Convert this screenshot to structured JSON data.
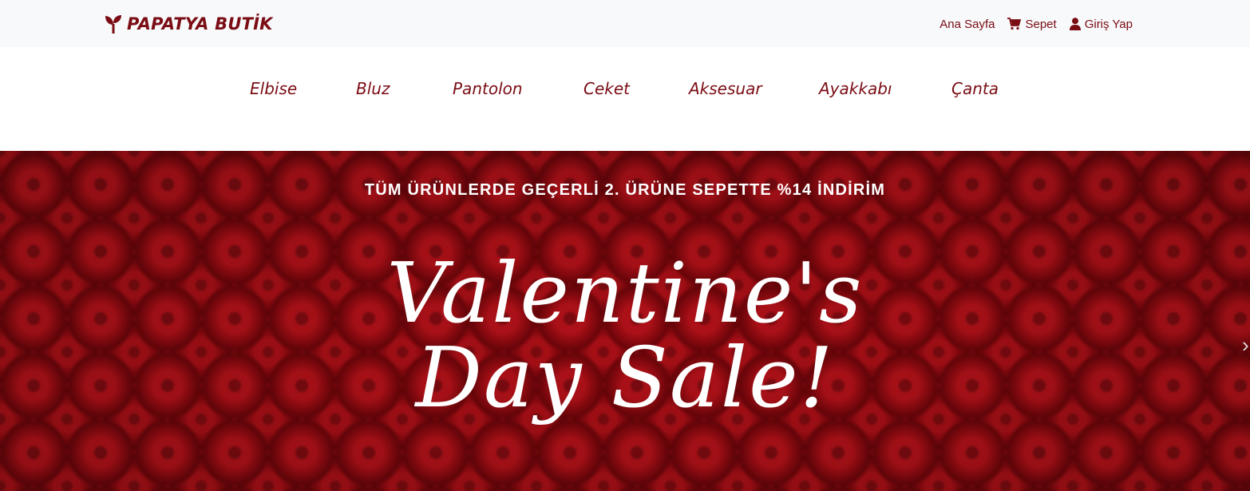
{
  "brand": {
    "name": "PAPATYA BUTİK",
    "icon": "seedling-icon",
    "color": "#7a0c14"
  },
  "top_nav": [
    {
      "label": "Ana Sayfa",
      "icon": ""
    },
    {
      "label": "Sepet",
      "icon": "cart-icon"
    },
    {
      "label": "Giriş Yap",
      "icon": "user-icon"
    }
  ],
  "categories": [
    "Elbise",
    "Bluz",
    "Pantolon",
    "Ceket",
    "Aksesuar",
    "Ayakkabı",
    "Çanta"
  ],
  "hero": {
    "promo_text": "TÜM ÜRÜNLERDE GEÇERLİ 2. ÜRÜNE SEPETTE %14 İNDİRİM",
    "headline_line1": "Valentine's",
    "headline_line2": "Day Sale!",
    "next_arrow": "›"
  }
}
